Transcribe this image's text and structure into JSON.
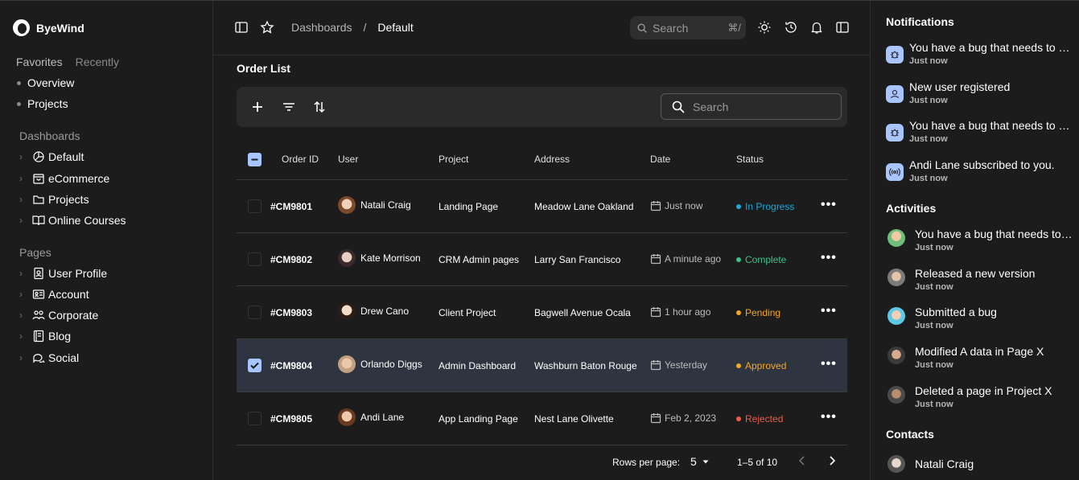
{
  "brand": {
    "name": "ByeWind"
  },
  "favorites": {
    "tabs": [
      "Favorites",
      "Recently"
    ],
    "items": [
      "Overview",
      "Projects"
    ]
  },
  "dashboards": {
    "title": "Dashboards",
    "items": [
      {
        "label": "Default",
        "icon": "pie-chart-icon"
      },
      {
        "label": "eCommerce",
        "icon": "shopping-bag-icon"
      },
      {
        "label": "Projects",
        "icon": "folder-icon"
      },
      {
        "label": "Online Courses",
        "icon": "book-open-icon"
      }
    ]
  },
  "pages": {
    "title": "Pages",
    "items": [
      {
        "label": "User Profile",
        "icon": "id-badge-icon"
      },
      {
        "label": "Account",
        "icon": "id-card-icon"
      },
      {
        "label": "Corporate",
        "icon": "users-icon"
      },
      {
        "label": "Blog",
        "icon": "notebook-icon"
      },
      {
        "label": "Social",
        "icon": "chat-bubbles-icon"
      }
    ]
  },
  "topbar": {
    "breadcrumb": [
      "Dashboards",
      "/",
      "Default"
    ],
    "search_placeholder": "Search",
    "shortcut": "⌘/"
  },
  "order_list": {
    "title": "Order List",
    "search_placeholder": "Search",
    "columns": [
      "Order ID",
      "User",
      "Project",
      "Address",
      "Date",
      "Status"
    ],
    "rows": [
      {
        "id": "#CM9801",
        "user": "Natali Craig",
        "project": "Landing Page",
        "address": "Meadow Lane Oakland",
        "date": "Just now",
        "status": "In Progress",
        "status_color": "#1ea7d8",
        "checked": false,
        "selected": false
      },
      {
        "id": "#CM9802",
        "user": "Kate Morrison",
        "project": "CRM Admin pages",
        "address": "Larry San Francisco",
        "date": "A minute ago",
        "status": "Complete",
        "status_color": "#3ec08a",
        "checked": false,
        "selected": false
      },
      {
        "id": "#CM9803",
        "user": "Drew Cano",
        "project": "Client Project",
        "address": "Bagwell Avenue Ocala",
        "date": "1 hour ago",
        "status": "Pending",
        "status_color": "#f5a623",
        "checked": false,
        "selected": false
      },
      {
        "id": "#CM9804",
        "user": "Orlando Diggs",
        "project": "Admin Dashboard",
        "address": "Washburn Baton Rouge",
        "date": "Yesterday",
        "status": "Approved",
        "status_color": "#f5a623",
        "checked": true,
        "selected": true
      },
      {
        "id": "#CM9805",
        "user": "Andi Lane",
        "project": "App Landing Page",
        "address": "Nest Lane Olivette",
        "date": "Feb 2, 2023",
        "status": "Rejected",
        "status_color": "#f05a47",
        "checked": false,
        "selected": false
      }
    ],
    "pagination": {
      "rows_label": "Rows per page:",
      "rows_value": "5",
      "range": "1–5 of 10"
    }
  },
  "notifications": {
    "title": "Notifications",
    "items": [
      {
        "text": "You have a bug that needs to be fixed.",
        "time": "Just now",
        "icon": "bug-icon"
      },
      {
        "text": "New user registered",
        "time": "Just now",
        "icon": "user-icon"
      },
      {
        "text": "You have a bug that needs to be fixed.",
        "time": "Just now",
        "icon": "bug-icon"
      },
      {
        "text": "Andi Lane subscribed to you.",
        "time": "Just now",
        "icon": "broadcast-icon"
      }
    ]
  },
  "activities": {
    "title": "Activities",
    "items": [
      {
        "text": "You have a bug that needs to be fixed.",
        "time": "Just now"
      },
      {
        "text": "Released a new version",
        "time": "Just now"
      },
      {
        "text": "Submitted a bug",
        "time": "Just now"
      },
      {
        "text": "Modified A data in Page X",
        "time": "Just now"
      },
      {
        "text": "Deleted a page in Project X",
        "time": "Just now"
      }
    ]
  },
  "contacts": {
    "title": "Contacts",
    "items": [
      {
        "name": "Natali Craig"
      }
    ]
  }
}
